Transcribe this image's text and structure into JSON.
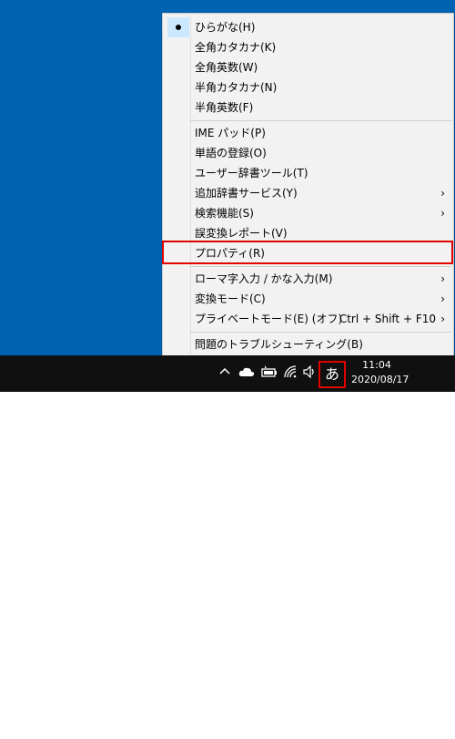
{
  "menu": {
    "items": [
      {
        "label": "ひらがな(H)",
        "checked": true
      },
      {
        "label": "全角カタカナ(K)"
      },
      {
        "label": "全角英数(W)"
      },
      {
        "label": "半角カタカナ(N)"
      },
      {
        "label": "半角英数(F)"
      },
      {
        "label": "IME パッド(P)"
      },
      {
        "label": "単語の登録(O)"
      },
      {
        "label": "ユーザー辞書ツール(T)"
      },
      {
        "label": "追加辞書サービス(Y)",
        "submenu": true
      },
      {
        "label": "検索機能(S)",
        "submenu": true
      },
      {
        "label": "誤変換レポート(V)"
      },
      {
        "label": "プロパティ(R)",
        "highlighted": true
      },
      {
        "label": "ローマ字入力 / かな入力(M)",
        "submenu": true
      },
      {
        "label": "変換モード(C)",
        "submenu": true
      },
      {
        "label": "プライベートモード(E) (オフ)",
        "shortcut": "Ctrl + Shift + F10",
        "submenu": true
      },
      {
        "label": "問題のトラブルシューティング(B)"
      }
    ]
  },
  "taskbar": {
    "ime_indicator": "あ",
    "time": "11:04",
    "date": "2020/08/17",
    "icons": [
      "chevron-up-icon",
      "cloud-icon",
      "battery-icon",
      "wifi-icon",
      "volume-icon",
      "notification-icon"
    ]
  },
  "colors": {
    "desktop": "#0063b1",
    "taskbar": "#101010",
    "highlight_border": "#e00000"
  }
}
